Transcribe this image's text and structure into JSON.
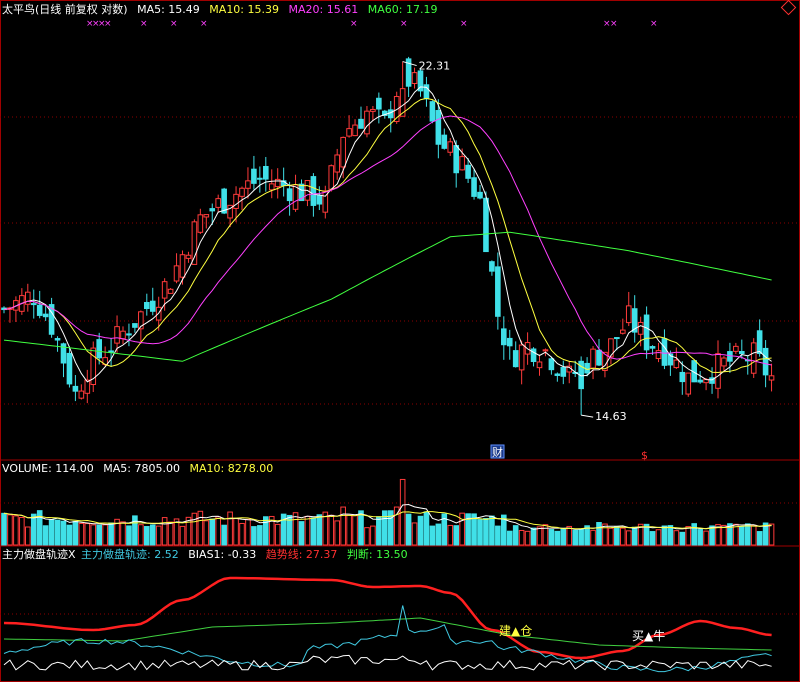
{
  "colors": {
    "bg": "#000000",
    "up": "#ff3b3b",
    "down": "#40e0e8",
    "ma5": "#ffffff",
    "ma10": "#ffff40",
    "ma20": "#ff40ff",
    "ma60": "#40ff40",
    "grid": "#8b0000",
    "trend_red": "#ff2020",
    "line_green": "#40d040",
    "line_cyan": "#40c8e0",
    "line_white": "#ffffff"
  },
  "header": {
    "title": "太平鸟(日线 前复权 对数)",
    "ma5": "MA5: 15.49",
    "ma10": "MA10: 15.39",
    "ma20": "MA20: 15.61",
    "ma60": "MA60: 17.19"
  },
  "volume_header": {
    "title": "VOLUME: 114.00",
    "ma5": "MA5: 7805.00",
    "ma10": "MA10: 8278.00"
  },
  "indicator_header": {
    "name1": "主力做盘轨迹X",
    "name2": "主力做盘轨迹: 2.52",
    "bias": "BIAS1: -0.33",
    "trend": "趋势线: 27.37",
    "judge": "判断: 13.50"
  },
  "annotations": {
    "high_label": "22.31",
    "low_label": "14.63",
    "cai_label": "财",
    "build_label": "建▲仓",
    "buy_label": "买▲牛",
    "s_label": "$",
    "x_mark": "×",
    "diamond_icon": "diamond-icon"
  },
  "chart_data": {
    "type": "candlestick",
    "title": "太平鸟(日线 前复权 对数)",
    "price_range": [
      14.0,
      23.5
    ],
    "grid": true,
    "highest": 22.31,
    "lowest": 14.63,
    "last_ma": {
      "MA5": 15.49,
      "MA10": 15.39,
      "MA20": 15.61,
      "MA60": 17.19
    },
    "last_volume": 114.0,
    "volume_ma": {
      "MA5": 7805.0,
      "MA10": 8278.0
    },
    "indicator": {
      "主力做盘轨迹": 2.52,
      "BIAS1": -0.33,
      "趋势线": 27.37,
      "判断": 13.5
    }
  }
}
